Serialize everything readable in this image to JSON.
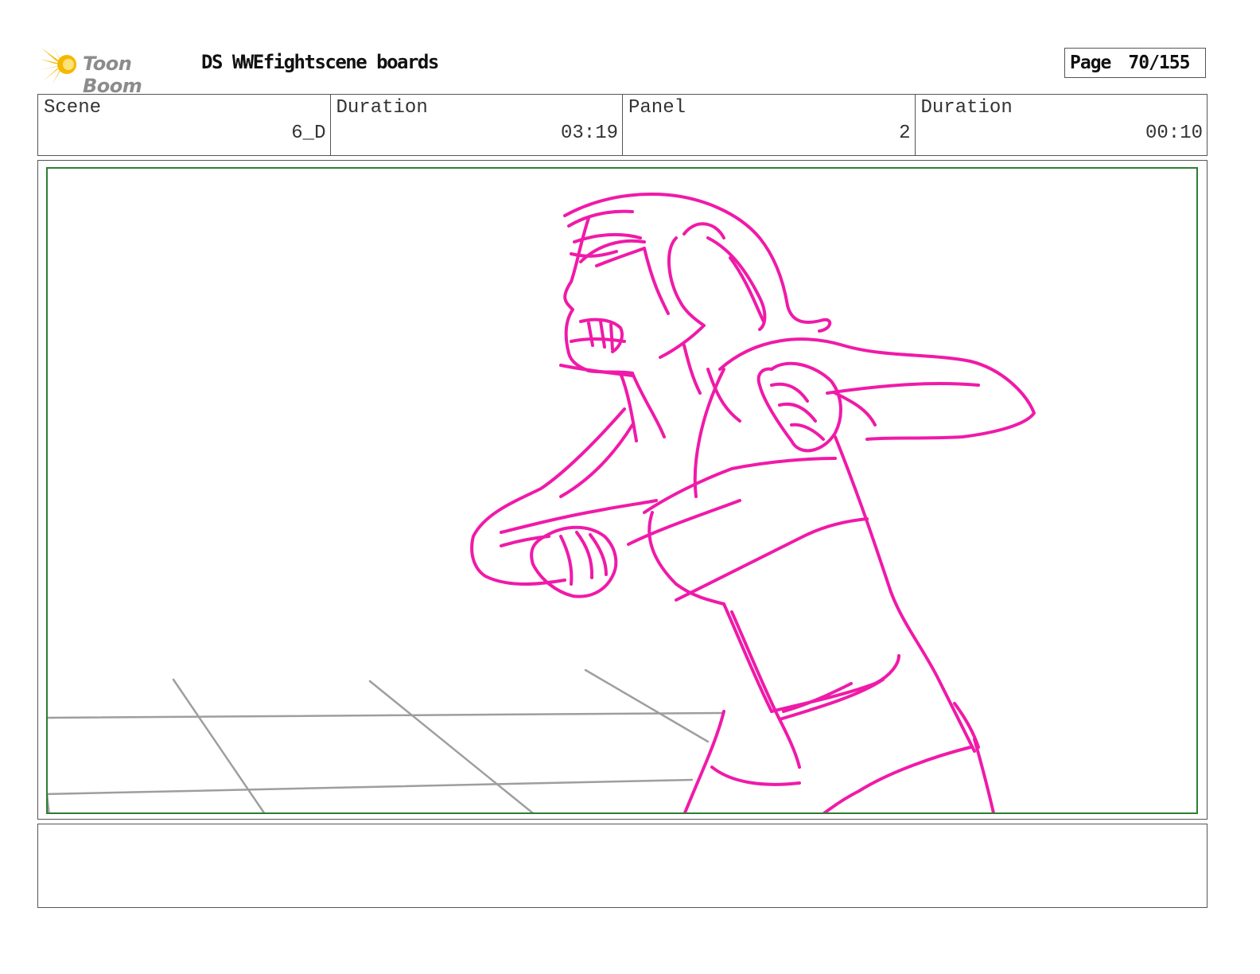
{
  "header": {
    "logo_text": "Toon Boom",
    "title": "DS WWEfightscene boards",
    "page_label": "Page",
    "page_number": "70/155"
  },
  "info": [
    {
      "label": "Scene",
      "value": "6_D"
    },
    {
      "label": "Duration",
      "value": "03:19"
    },
    {
      "label": "Panel",
      "value": "2"
    },
    {
      "label": "Duration",
      "value": "00:10"
    }
  ],
  "colors": {
    "sketch": "#f01aa8",
    "guide_lines": "#9e9e9e",
    "safe_frame": "#2e7d32",
    "logo_star": "#f5b800"
  },
  "notes": ""
}
